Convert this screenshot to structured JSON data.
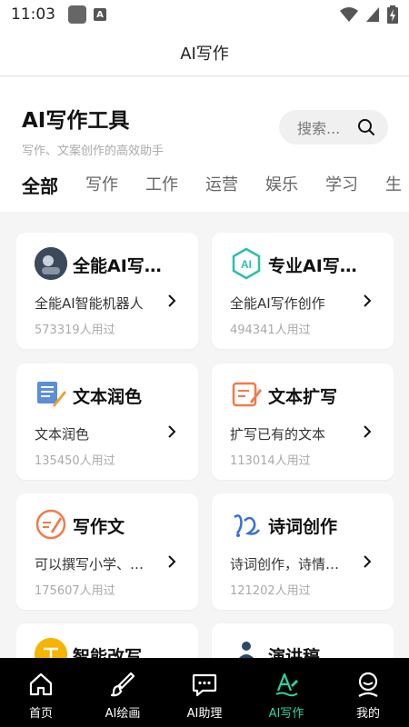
{
  "status_bar": {
    "time": "11:03",
    "notif_letter": "A"
  },
  "app_title": "AI写作",
  "header": {
    "title": "AI写作工具",
    "subtitle": "写作、文案创作的高效助手",
    "search_placeholder": "搜索..."
  },
  "tabs": [
    "全部",
    "写作",
    "工作",
    "运营",
    "娱乐",
    "学习",
    "生"
  ],
  "active_tab": 0,
  "cards": [
    {
      "icon": "robot-avatar-icon",
      "title": "全能AI写…",
      "desc": "全能AI智能机器人",
      "users": "573319人用过"
    },
    {
      "icon": "ai-hexagon-icon",
      "title": "专业AI写…",
      "desc": "全能AI写作创作",
      "users": "494341人用过"
    },
    {
      "icon": "document-brush-icon",
      "title": "文本润色",
      "desc": "文本润色",
      "users": "135450人用过"
    },
    {
      "icon": "edit-document-icon",
      "title": "文本扩写",
      "desc": "扩写已有的文本",
      "users": "113014人用过"
    },
    {
      "icon": "pen-circle-icon",
      "title": "写作文",
      "desc": "可以撰写小学、…",
      "users": "175607人用过"
    },
    {
      "icon": "poetry-icon",
      "title": "诗词创作",
      "desc": "诗词创作，诗情…",
      "users": "121202人用过"
    },
    {
      "icon": "rewrite-icon",
      "title": "智能改写",
      "desc": "",
      "users": ""
    },
    {
      "icon": "speech-podium-icon",
      "title": "演讲稿",
      "desc": "",
      "users": ""
    }
  ],
  "bottom_nav": [
    {
      "label": "首页",
      "icon": "home-icon"
    },
    {
      "label": "AI绘画",
      "icon": "brush-icon"
    },
    {
      "label": "AI助理",
      "icon": "chat-icon"
    },
    {
      "label": "AI写作",
      "icon": "writing-icon",
      "active": true
    },
    {
      "label": "我的",
      "icon": "profile-icon"
    }
  ],
  "colors": {
    "accent": "#2fd3a4",
    "nav_bg": "#000000",
    "card_bg": "#ffffff",
    "page_bg": "#f5f5f5"
  }
}
